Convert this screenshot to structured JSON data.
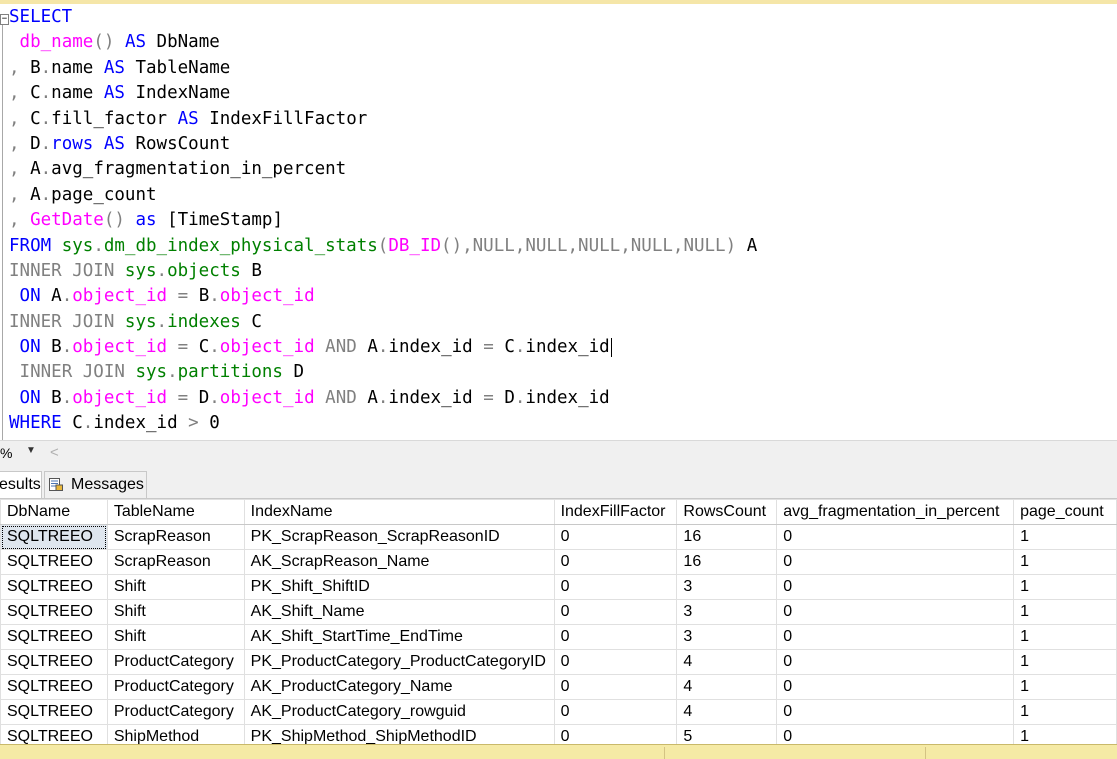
{
  "editor": {
    "lines": [
      [
        {
          "t": "SELECT",
          "c": "k"
        }
      ],
      [
        {
          "t": " "
        },
        {
          "t": "db_name",
          "c": "f"
        },
        {
          "t": "()",
          "c": "g"
        },
        {
          "t": " "
        },
        {
          "t": "AS",
          "c": "k"
        },
        {
          "t": " DbName"
        }
      ],
      [
        {
          "t": ", ",
          "c": "g"
        },
        {
          "t": "B"
        },
        {
          "t": ".",
          "c": "g"
        },
        {
          "t": "name "
        },
        {
          "t": "AS",
          "c": "k"
        },
        {
          "t": " TableName"
        }
      ],
      [
        {
          "t": ", ",
          "c": "g"
        },
        {
          "t": "C"
        },
        {
          "t": ".",
          "c": "g"
        },
        {
          "t": "name "
        },
        {
          "t": "AS",
          "c": "k"
        },
        {
          "t": " IndexName"
        }
      ],
      [
        {
          "t": ", ",
          "c": "g"
        },
        {
          "t": "C"
        },
        {
          "t": ".",
          "c": "g"
        },
        {
          "t": "fill_factor "
        },
        {
          "t": "AS",
          "c": "k"
        },
        {
          "t": " IndexFillFactor"
        }
      ],
      [
        {
          "t": ", ",
          "c": "g"
        },
        {
          "t": "D"
        },
        {
          "t": ".",
          "c": "g"
        },
        {
          "t": "rows",
          "c": "k"
        },
        {
          "t": " "
        },
        {
          "t": "AS",
          "c": "k"
        },
        {
          "t": " RowsCount"
        }
      ],
      [
        {
          "t": ", ",
          "c": "g"
        },
        {
          "t": "A"
        },
        {
          "t": ".",
          "c": "g"
        },
        {
          "t": "avg_fragmentation_in_percent"
        }
      ],
      [
        {
          "t": ", ",
          "c": "g"
        },
        {
          "t": "A"
        },
        {
          "t": ".",
          "c": "g"
        },
        {
          "t": "page_count"
        }
      ],
      [
        {
          "t": ", ",
          "c": "g"
        },
        {
          "t": "GetDate",
          "c": "f"
        },
        {
          "t": "()",
          "c": "g"
        },
        {
          "t": " "
        },
        {
          "t": "as",
          "c": "k"
        },
        {
          "t": " [TimeStamp]"
        }
      ],
      [
        {
          "t": "FROM",
          "c": "k"
        },
        {
          "t": " "
        },
        {
          "t": "sys",
          "c": "s"
        },
        {
          "t": ".",
          "c": "g"
        },
        {
          "t": "dm_db_index_physical_stats",
          "c": "s"
        },
        {
          "t": "(",
          "c": "g"
        },
        {
          "t": "DB_ID",
          "c": "f"
        },
        {
          "t": "(),",
          "c": "g"
        },
        {
          "t": "NULL",
          "c": "g"
        },
        {
          "t": ",",
          "c": "g"
        },
        {
          "t": "NULL",
          "c": "g"
        },
        {
          "t": ",",
          "c": "g"
        },
        {
          "t": "NULL",
          "c": "g"
        },
        {
          "t": ",",
          "c": "g"
        },
        {
          "t": "NULL",
          "c": "g"
        },
        {
          "t": ",",
          "c": "g"
        },
        {
          "t": "NULL",
          "c": "g"
        },
        {
          "t": ")",
          "c": "g"
        },
        {
          "t": " A"
        }
      ],
      [
        {
          "t": "INNER JOIN",
          "c": "g"
        },
        {
          "t": " "
        },
        {
          "t": "sys",
          "c": "s"
        },
        {
          "t": ".",
          "c": "g"
        },
        {
          "t": "objects",
          "c": "s"
        },
        {
          "t": " B"
        }
      ],
      [
        {
          "t": " "
        },
        {
          "t": "ON",
          "c": "k"
        },
        {
          "t": " A"
        },
        {
          "t": ".",
          "c": "g"
        },
        {
          "t": "object_id",
          "c": "f"
        },
        {
          "t": " "
        },
        {
          "t": "=",
          "c": "g"
        },
        {
          "t": " B"
        },
        {
          "t": ".",
          "c": "g"
        },
        {
          "t": "object_id",
          "c": "f"
        }
      ],
      [
        {
          "t": "INNER JOIN",
          "c": "g"
        },
        {
          "t": " "
        },
        {
          "t": "sys",
          "c": "s"
        },
        {
          "t": ".",
          "c": "g"
        },
        {
          "t": "indexes",
          "c": "s"
        },
        {
          "t": " C"
        }
      ],
      [
        {
          "t": " "
        },
        {
          "t": "ON",
          "c": "k"
        },
        {
          "t": " B"
        },
        {
          "t": ".",
          "c": "g"
        },
        {
          "t": "object_id",
          "c": "f"
        },
        {
          "t": " "
        },
        {
          "t": "=",
          "c": "g"
        },
        {
          "t": " C"
        },
        {
          "t": ".",
          "c": "g"
        },
        {
          "t": "object_id",
          "c": "f"
        },
        {
          "t": " "
        },
        {
          "t": "AND",
          "c": "g"
        },
        {
          "t": " A"
        },
        {
          "t": ".",
          "c": "g"
        },
        {
          "t": "index_id "
        },
        {
          "t": "=",
          "c": "g"
        },
        {
          "t": " C"
        },
        {
          "t": ".",
          "c": "g"
        },
        {
          "t": "index_id"
        },
        {
          "caret": true
        }
      ],
      [
        {
          "t": " "
        },
        {
          "t": "INNER JOIN",
          "c": "g"
        },
        {
          "t": " "
        },
        {
          "t": "sys",
          "c": "s"
        },
        {
          "t": ".",
          "c": "g"
        },
        {
          "t": "partitions",
          "c": "s"
        },
        {
          "t": " D"
        }
      ],
      [
        {
          "t": " "
        },
        {
          "t": "ON",
          "c": "k"
        },
        {
          "t": " B"
        },
        {
          "t": ".",
          "c": "g"
        },
        {
          "t": "object_id",
          "c": "f"
        },
        {
          "t": " "
        },
        {
          "t": "=",
          "c": "g"
        },
        {
          "t": " D"
        },
        {
          "t": ".",
          "c": "g"
        },
        {
          "t": "object_id",
          "c": "f"
        },
        {
          "t": " "
        },
        {
          "t": "AND",
          "c": "g"
        },
        {
          "t": " A"
        },
        {
          "t": ".",
          "c": "g"
        },
        {
          "t": "index_id "
        },
        {
          "t": "=",
          "c": "g"
        },
        {
          "t": " D"
        },
        {
          "t": ".",
          "c": "g"
        },
        {
          "t": "index_id"
        }
      ],
      [
        {
          "t": "WHERE",
          "c": "k"
        },
        {
          "t": " C"
        },
        {
          "t": ".",
          "c": "g"
        },
        {
          "t": "index_id "
        },
        {
          "t": ">",
          "c": "g"
        },
        {
          "t": " 0"
        }
      ]
    ]
  },
  "zoom": {
    "value": "%",
    "dropdown_arrow": "▼",
    "scroll_left": "<"
  },
  "tabs": {
    "results": "esults",
    "messages": "Messages"
  },
  "grid": {
    "columns": [
      "DbName",
      "TableName",
      "IndexName",
      "IndexFillFactor",
      "RowsCount",
      "avg_fragmentation_in_percent",
      "page_count"
    ],
    "rows": [
      [
        "SQLTREEO",
        "ScrapReason",
        "PK_ScrapReason_ScrapReasonID",
        "0",
        "16",
        "0",
        "1"
      ],
      [
        "SQLTREEO",
        "ScrapReason",
        "AK_ScrapReason_Name",
        "0",
        "16",
        "0",
        "1"
      ],
      [
        "SQLTREEO",
        "Shift",
        "PK_Shift_ShiftID",
        "0",
        "3",
        "0",
        "1"
      ],
      [
        "SQLTREEO",
        "Shift",
        "AK_Shift_Name",
        "0",
        "3",
        "0",
        "1"
      ],
      [
        "SQLTREEO",
        "Shift",
        "AK_Shift_StartTime_EndTime",
        "0",
        "3",
        "0",
        "1"
      ],
      [
        "SQLTREEO",
        "ProductCategory",
        "PK_ProductCategory_ProductCategoryID",
        "0",
        "4",
        "0",
        "1"
      ],
      [
        "SQLTREEO",
        "ProductCategory",
        "AK_ProductCategory_Name",
        "0",
        "4",
        "0",
        "1"
      ],
      [
        "SQLTREEO",
        "ProductCategory",
        "AK_ProductCategory_rowguid",
        "0",
        "4",
        "0",
        "1"
      ],
      [
        "SQLTREEO",
        "ShipMethod",
        "PK_ShipMethod_ShipMethodID",
        "0",
        "5",
        "0",
        "1"
      ]
    ]
  },
  "colors": {
    "keyword": "#0000ff",
    "function": "#ff00ff",
    "system_object": "#008000",
    "operator": "#808080",
    "status_bar": "#f5eaa5"
  },
  "icons": {
    "messages_tab": "messages-icon",
    "collapse": "collapse-minus-icon"
  }
}
